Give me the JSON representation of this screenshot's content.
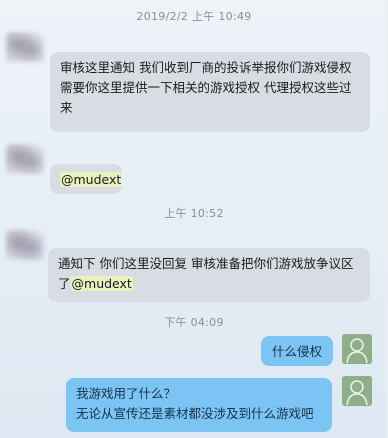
{
  "timestamps": [
    "2019/2/2 上午 10:49",
    "上午 10:52",
    "下午 04:09"
  ],
  "messages": {
    "m1_line1": "审核这里通知 我们收到厂商的投诉举报你们游戏侵权",
    "m1_line2": "需要你这里提供一下相关的游戏授权 代理授权这些过",
    "m1_line3": "来",
    "m2": "@mudext",
    "m3_line1": "通知下 你们这里没回复 审核准备把你们游戏放争议区",
    "m3_line2_prefix": "了",
    "m3_line2_mention": "@mudext",
    "m4": "什么侵权",
    "m5_line1": "我游戏用了什么？",
    "m5_line2": "无论从宣传还是素材都没涉及到什么游戏吧"
  },
  "colors": {
    "incoming_bubble": "#d8dde4",
    "outgoing_bubble": "#7cc4f4",
    "mention_highlight": "#e9f1c0"
  },
  "icons": {
    "my_avatar": "person-silhouette-icon"
  }
}
